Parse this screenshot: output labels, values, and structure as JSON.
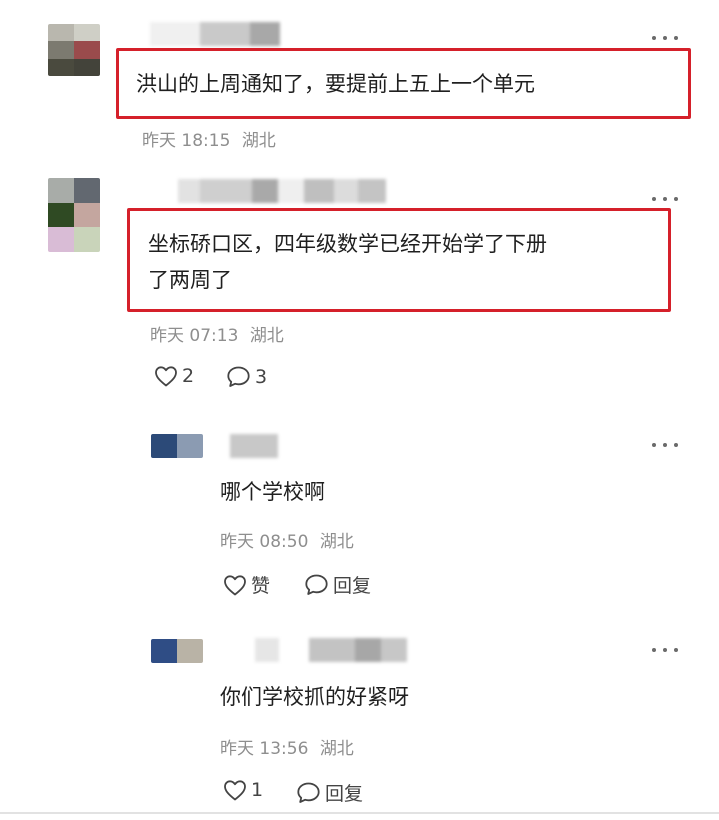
{
  "comments": [
    {
      "text": "洪山的上周通知了，要提前上五上一个单元",
      "time": "昨天 18:15",
      "location": "湖北"
    },
    {
      "text": "坐标硚口区，四年级数学已经开始学了下册\n了两周了",
      "time": "昨天 07:13",
      "location": "湖北",
      "likes": "2",
      "reply_count": "3"
    }
  ],
  "replies": [
    {
      "text": "哪个学校啊",
      "time": "昨天 08:50",
      "location": "湖北",
      "like_label": "赞",
      "reply_label": "回复"
    },
    {
      "text": "你们学校抓的好紧呀",
      "time": "昨天 13:56",
      "location": "湖北",
      "likes": "1",
      "reply_label": "回复"
    }
  ],
  "colors": {
    "highlight": "#d5202a",
    "meta_text": "#8e8e8e",
    "icon_stroke": "#444444"
  },
  "icons": {
    "like": "heart-outline-icon",
    "comment": "speech-bubble-icon",
    "more": "more-dots-icon"
  }
}
